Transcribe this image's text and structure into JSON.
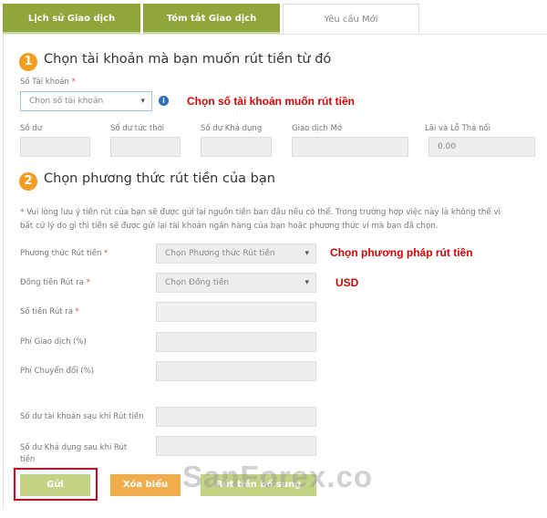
{
  "tabs": [
    {
      "label": "Lịch sử Giao dịch"
    },
    {
      "label": "Tóm tắt Giao dịch"
    },
    {
      "label": "Yêu cầu Mới"
    }
  ],
  "section1": {
    "number": "1",
    "title": "Chọn tài khoản mà bạn muốn rút tiền từ đó",
    "account_label": "Số Tài khoản",
    "required_mark": "*",
    "account_placeholder": "Chọn số tài khoản",
    "annotation": "Chọn số tài khoản muốn rút tiền",
    "balances": [
      {
        "label": "Số dư",
        "value": ""
      },
      {
        "label": "Số dư tức thời",
        "value": ""
      },
      {
        "label": "Số dư Khả dụng",
        "value": ""
      },
      {
        "label": "Giao dịch Mở",
        "value": ""
      },
      {
        "label": "Lãi và Lỗ Thả nổi",
        "value": "0.00"
      }
    ]
  },
  "section2": {
    "number": "2",
    "title": "Chọn phương thức rút tiền của bạn",
    "note_line1": "* Vui lòng lưu ý tiền rút của bạn sẽ được gửi lại nguồn tiền ban đầu nếu có thể. Trong trường hợp việc này là không thể vì",
    "note_line2": "bất cứ lý do gì thì tiền sẽ được gửi lại tài khoản ngân hàng của bạn hoặc phương thức ví mà bạn đã chọn.",
    "fields": [
      {
        "label": "Phương thức Rút tiền",
        "required": "*",
        "value": "Chọn Phương thức Rút tiền"
      },
      {
        "label": "Đồng tiền Rút ra",
        "required": "*",
        "value": "Chọn Đồng tiền"
      },
      {
        "label": "Số tiền Rút ra",
        "required": "*",
        "value": ""
      },
      {
        "label": "Phí Giao dịch (%)",
        "value": ""
      },
      {
        "label": "Phí Chuyển đổi (%)",
        "value": ""
      },
      {
        "label": "Số dư tài khoản sau khi Rút tiền",
        "value": ""
      },
      {
        "label": "Số dư Khả dụng sau khi Rút tiền",
        "value": ""
      }
    ],
    "annotation_method": "Chọn phương pháp rút tiền",
    "annotation_currency": "USD"
  },
  "buttons": {
    "submit": "Gửi",
    "clear": "Xóa biểu mẫu",
    "additional": "Rút tiền bổ sung"
  },
  "watermark": "SanForex.co",
  "colors": {
    "tab_green": "#8ea63a",
    "step_orange": "#f39c1f",
    "annotation_red": "#e00000",
    "clear_orange": "#f0ad4e",
    "submit_green": "#c3d384"
  }
}
